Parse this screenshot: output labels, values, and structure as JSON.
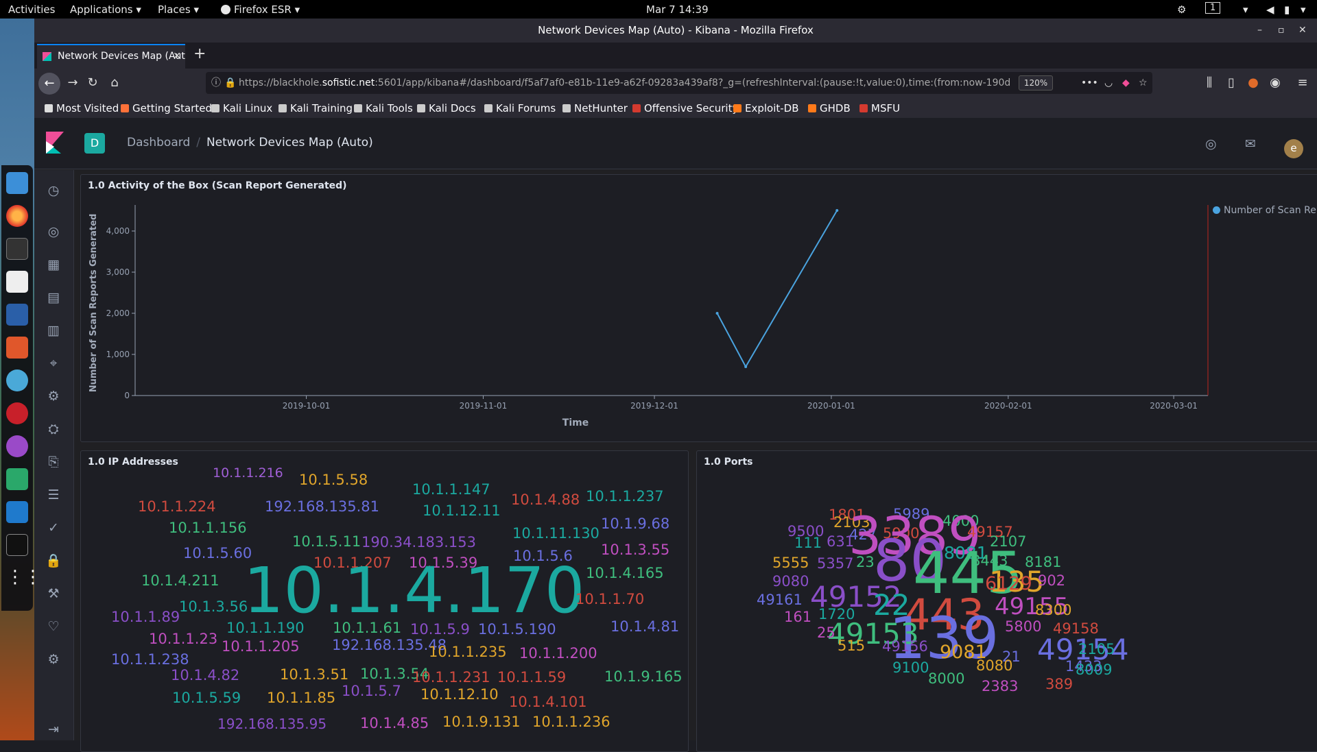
{
  "os_bar": {
    "activities": "Activities",
    "applications": "Applications ▾",
    "places": "Places ▾",
    "firefox": "Firefox ESR ▾",
    "clock": "Mar 7  14:39",
    "workspace": "1"
  },
  "window": {
    "title": "Network Devices Map (Auto) - Kibana - Mozilla Firefox"
  },
  "browser": {
    "tab_title": "Network Devices Map (Auto)",
    "url_prefix": "https://blackhole.",
    "url_domain": "sofistic.net",
    "url_rest": ":5601/app/kibana#/dashboard/f5af7af0-e81b-11e9-a62f-09283a439af8?_g=(refreshInterval:(pause:!t,value:0),time:(from:now-190d",
    "zoom": "120%",
    "bookmarks": [
      {
        "label": "Most Visited",
        "icon": "gear-icon",
        "color": "#dddddd"
      },
      {
        "label": "Getting Started",
        "icon": "firefox-icon",
        "color": "#ff7139"
      },
      {
        "label": "Kali Linux",
        "icon": "kali-dragon-icon",
        "color": "#cccccc"
      },
      {
        "label": "Kali Training",
        "icon": "kali-dragon-icon",
        "color": "#cccccc"
      },
      {
        "label": "Kali Tools",
        "icon": "kali-dragon-icon",
        "color": "#cccccc"
      },
      {
        "label": "Kali Docs",
        "icon": "kali-dragon-icon",
        "color": "#cccccc"
      },
      {
        "label": "Kali Forums",
        "icon": "kali-dragon-icon",
        "color": "#cccccc"
      },
      {
        "label": "NetHunter",
        "icon": "kali-dragon-icon",
        "color": "#cccccc"
      },
      {
        "label": "Offensive Security",
        "icon": "offsec-icon",
        "color": "#d43a2f"
      },
      {
        "label": "Exploit-DB",
        "icon": "exploitdb-icon",
        "color": "#ff7a1a"
      },
      {
        "label": "GHDB",
        "icon": "ghdb-icon",
        "color": "#ff7a1a"
      },
      {
        "label": "MSFU",
        "icon": "offsec-icon",
        "color": "#d43a2f"
      }
    ]
  },
  "kibana": {
    "space_initial": "D",
    "breadcrumb_root": "Dashboard",
    "breadcrumb_current": "Network Devices Map (Auto)",
    "user_initial": "e"
  },
  "panels": {
    "activity_title": "1.0 Activity of the Box (Scan Report Generated)",
    "ips_title": "1.0 IP Addresses",
    "ports_title": "1.0 Ports"
  },
  "chart_data": {
    "type": "line",
    "xlabel": "Time",
    "ylabel": "Number of Scan Reports Generated",
    "x_ticks": [
      "2019-10-01",
      "2019-11-01",
      "2019-12-01",
      "2020-01-01",
      "2020-02-01",
      "2020-03-01"
    ],
    "y_ticks": [
      "0",
      "1,000",
      "2,000",
      "3,000",
      "4,000"
    ],
    "ylim": [
      0,
      4500
    ],
    "xlim": [
      "2019-09-01",
      "2020-03-07"
    ],
    "grid": false,
    "legend_position": "top-right",
    "series": [
      {
        "name": "Number of Scan Rep...",
        "color": "#4aa3df",
        "points": [
          {
            "x": "2019-12-12",
            "y": 2000
          },
          {
            "x": "2019-12-17",
            "y": 700
          },
          {
            "x": "2020-01-02",
            "y": 4500
          }
        ]
      }
    ]
  },
  "ip_cloud": [
    {
      "t": "10.1.1.216",
      "c": "#a05fd6",
      "s": 19
    },
    {
      "t": "10.1.5.58",
      "c": "#e0a52b",
      "s": 21
    },
    {
      "t": "10.1.1.147",
      "c": "#1ba9a0",
      "s": 21
    },
    {
      "t": "10.1.1.237",
      "c": "#1ba9a0",
      "s": 21
    },
    {
      "t": "10.1.1.224",
      "c": "#d14b3f",
      "s": 21
    },
    {
      "t": "192.168.135.81",
      "c": "#6a6fe0",
      "s": 21
    },
    {
      "t": "10.1.12.11",
      "c": "#1ba9a0",
      "s": 21
    },
    {
      "t": "10.1.4.88",
      "c": "#d14b3f",
      "s": 21
    },
    {
      "t": "10.1.1.156",
      "c": "#3fbe7e",
      "s": 21
    },
    {
      "t": "10.1.5.11",
      "c": "#3fbe7e",
      "s": 21
    },
    {
      "t": "190.34.183.153",
      "c": "#8a4fc8",
      "s": 21
    },
    {
      "t": "10.1.11.130",
      "c": "#1ba9a0",
      "s": 21
    },
    {
      "t": "10.1.9.68",
      "c": "#6a6fe0",
      "s": 21
    },
    {
      "t": "10.1.5.60",
      "c": "#6a6fe0",
      "s": 21
    },
    {
      "t": "10.1.1.207",
      "c": "#d14b3f",
      "s": 21
    },
    {
      "t": "10.1.5.39",
      "c": "#c04fc0",
      "s": 21
    },
    {
      "t": "10.1.5.6",
      "c": "#6a6fe0",
      "s": 21
    },
    {
      "t": "10.1.3.55",
      "c": "#c04fc0",
      "s": 21
    },
    {
      "t": "10.1.4.211",
      "c": "#3fbe7e",
      "s": 21
    },
    {
      "t": "10.1.4.165",
      "c": "#3fbe7e",
      "s": 21
    },
    {
      "t": "10.1.4.170",
      "c": "#1ba9a0",
      "s": 92
    },
    {
      "t": "10.1.1.70",
      "c": "#d14b3f",
      "s": 21
    },
    {
      "t": "10.1.3.56",
      "c": "#1ba9a0",
      "s": 21
    },
    {
      "t": "10.1.1.89",
      "c": "#8a4fc8",
      "s": 21
    },
    {
      "t": "10.1.1.190",
      "c": "#1ba9a0",
      "s": 21
    },
    {
      "t": "10.1.1.61",
      "c": "#3fbe7e",
      "s": 21
    },
    {
      "t": "10.1.5.9",
      "c": "#8a4fc8",
      "s": 21
    },
    {
      "t": "10.1.5.190",
      "c": "#6a6fe0",
      "s": 21
    },
    {
      "t": "10.1.4.81",
      "c": "#6a6fe0",
      "s": 21
    },
    {
      "t": "10.1.1.23",
      "c": "#c04fc0",
      "s": 21
    },
    {
      "t": "10.1.1.205",
      "c": "#c04fc0",
      "s": 21
    },
    {
      "t": "192.168.135.48",
      "c": "#6a6fe0",
      "s": 21
    },
    {
      "t": "10.1.1.235",
      "c": "#e0a52b",
      "s": 21
    },
    {
      "t": "10.1.1.200",
      "c": "#c04fc0",
      "s": 21
    },
    {
      "t": "10.1.1.238",
      "c": "#6a6fe0",
      "s": 21
    },
    {
      "t": "10.1.4.82",
      "c": "#8a4fc8",
      "s": 21
    },
    {
      "t": "10.1.3.51",
      "c": "#e0a52b",
      "s": 21
    },
    {
      "t": "10.1.3.54",
      "c": "#3fbe7e",
      "s": 21
    },
    {
      "t": "10.1.1.231",
      "c": "#d14b3f",
      "s": 21
    },
    {
      "t": "10.1.1.59",
      "c": "#d14b3f",
      "s": 21
    },
    {
      "t": "10.1.9.165",
      "c": "#3fbe7e",
      "s": 21
    },
    {
      "t": "10.1.5.59",
      "c": "#1ba9a0",
      "s": 21
    },
    {
      "t": "10.1.1.85",
      "c": "#e0a52b",
      "s": 21
    },
    {
      "t": "10.1.5.7",
      "c": "#8a4fc8",
      "s": 21
    },
    {
      "t": "10.1.12.10",
      "c": "#e0a52b",
      "s": 21
    },
    {
      "t": "10.1.4.101",
      "c": "#d14b3f",
      "s": 21
    },
    {
      "t": "192.168.135.95",
      "c": "#8a4fc8",
      "s": 20
    },
    {
      "t": "10.1.4.85",
      "c": "#c04fc0",
      "s": 21
    },
    {
      "t": "10.1.9.131",
      "c": "#e0a52b",
      "s": 21
    },
    {
      "t": "10.1.1.236",
      "c": "#e0a52b",
      "s": 21
    }
  ],
  "port_cloud": [
    {
      "t": "1801",
      "c": "#d14b3f",
      "s": 21
    },
    {
      "t": "5989",
      "c": "#6a6fe0",
      "s": 21
    },
    {
      "t": "2103",
      "c": "#e0a52b",
      "s": 21
    },
    {
      "t": "4000",
      "c": "#3fbe7e",
      "s": 21
    },
    {
      "t": "9500",
      "c": "#8a4fc8",
      "s": 21
    },
    {
      "t": "427",
      "c": "#6a6fe0",
      "s": 21
    },
    {
      "t": "5900",
      "c": "#d14b3f",
      "s": 21
    },
    {
      "t": "3389",
      "c": "#c04fc0",
      "s": 76
    },
    {
      "t": "49157",
      "c": "#d14b3f",
      "s": 21
    },
    {
      "t": "111",
      "c": "#1ba9a0",
      "s": 21
    },
    {
      "t": "631",
      "c": "#8a4fc8",
      "s": 21
    },
    {
      "t": "2107",
      "c": "#3fbe7e",
      "s": 21
    },
    {
      "t": "8081",
      "c": "#1ba9a0",
      "s": 25
    },
    {
      "t": "5555",
      "c": "#e0a52b",
      "s": 21
    },
    {
      "t": "5357",
      "c": "#8a4fc8",
      "s": 21
    },
    {
      "t": "23",
      "c": "#3fbe7e",
      "s": 21
    },
    {
      "t": "80",
      "c": "#8a4fc8",
      "s": 84
    },
    {
      "t": "8443",
      "c": "#3fbe7e",
      "s": 21
    },
    {
      "t": "8181",
      "c": "#3fbe7e",
      "s": 21
    },
    {
      "t": "9080",
      "c": "#8a4fc8",
      "s": 21
    },
    {
      "t": "445",
      "c": "#3fbe7e",
      "s": 84
    },
    {
      "t": "135",
      "c": "#e0a52b",
      "s": 42
    },
    {
      "t": "6129",
      "c": "#d14b3f",
      "s": 27
    },
    {
      "t": "902",
      "c": "#c04fc0",
      "s": 21
    },
    {
      "t": "49161",
      "c": "#6a6fe0",
      "s": 21
    },
    {
      "t": "49152",
      "c": "#8a4fc8",
      "s": 42
    },
    {
      "t": "22",
      "c": "#1ba9a0",
      "s": 42
    },
    {
      "t": "443",
      "c": "#d14b3f",
      "s": 62
    },
    {
      "t": "49155",
      "c": "#c04fc0",
      "s": 34
    },
    {
      "t": "8300",
      "c": "#e0a52b",
      "s": 21
    },
    {
      "t": "161",
      "c": "#c04fc0",
      "s": 21
    },
    {
      "t": "1720",
      "c": "#1ba9a0",
      "s": 21
    },
    {
      "t": "139",
      "c": "#6a6fe0",
      "s": 84
    },
    {
      "t": "49153",
      "c": "#3fbe7e",
      "s": 42
    },
    {
      "t": "5800",
      "c": "#c04fc0",
      "s": 21
    },
    {
      "t": "49158",
      "c": "#d14b3f",
      "s": 21
    },
    {
      "t": "25",
      "c": "#c04fc0",
      "s": 21
    },
    {
      "t": "49154",
      "c": "#6a6fe0",
      "s": 42
    },
    {
      "t": "515",
      "c": "#e0a52b",
      "s": 21
    },
    {
      "t": "49156",
      "c": "#8a4fc8",
      "s": 21
    },
    {
      "t": "9081",
      "c": "#e0a52b",
      "s": 27
    },
    {
      "t": "21",
      "c": "#6a6fe0",
      "s": 21
    },
    {
      "t": "2105",
      "c": "#1ba9a0",
      "s": 21
    },
    {
      "t": "8080",
      "c": "#e0a52b",
      "s": 21
    },
    {
      "t": "1433",
      "c": "#6a6fe0",
      "s": 21
    },
    {
      "t": "9100",
      "c": "#1ba9a0",
      "s": 21
    },
    {
      "t": "8009",
      "c": "#1ba9a0",
      "s": 21
    },
    {
      "t": "8000",
      "c": "#3fbe7e",
      "s": 21
    },
    {
      "t": "2383",
      "c": "#c04fc0",
      "s": 21
    },
    {
      "t": "389",
      "c": "#d14b3f",
      "s": 21
    }
  ]
}
